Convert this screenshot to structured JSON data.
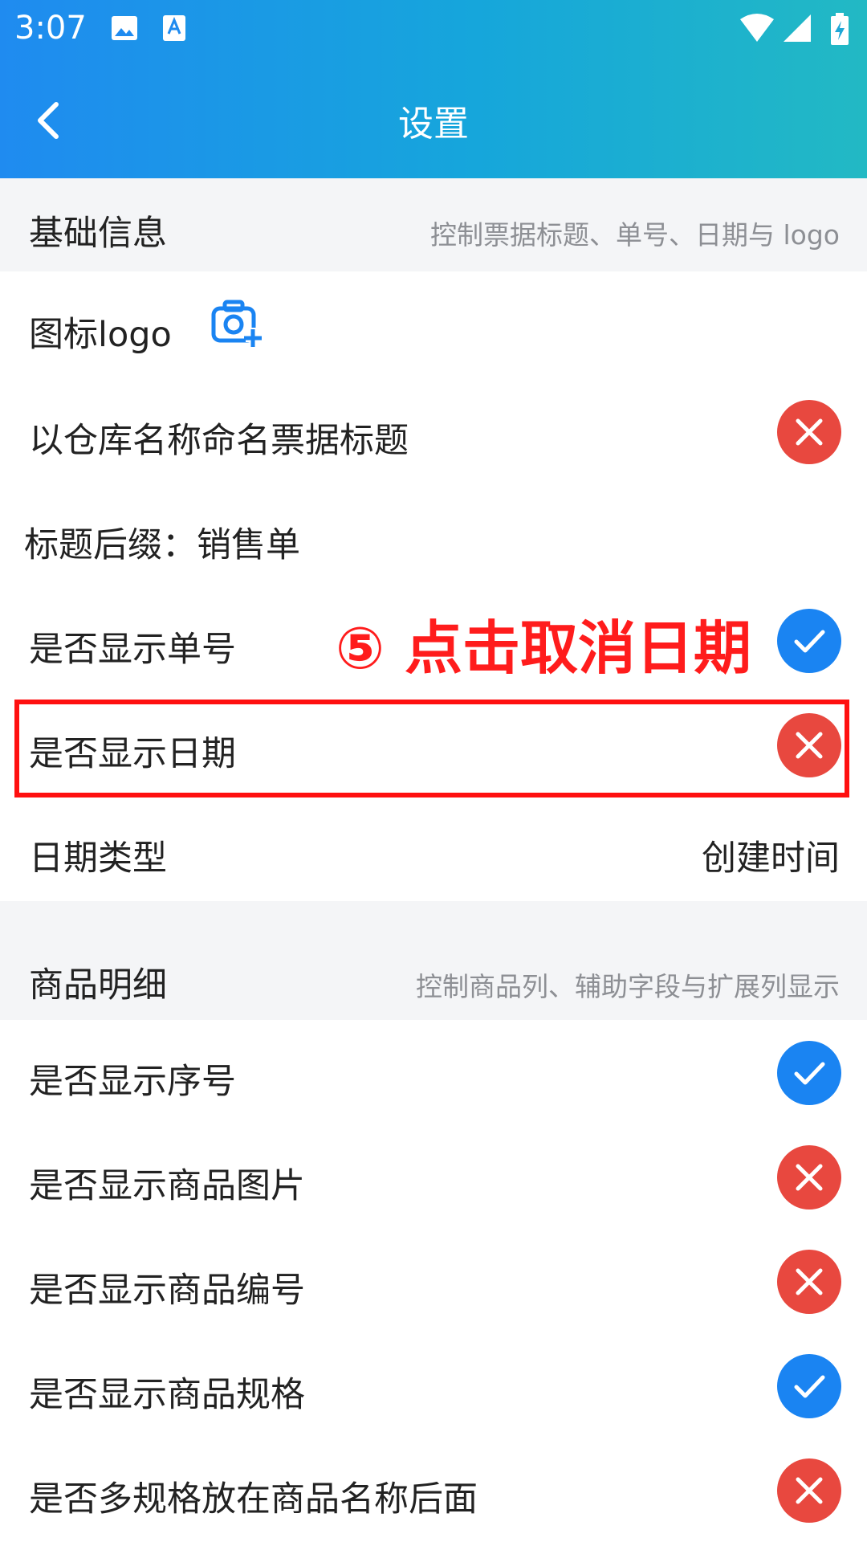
{
  "status_bar": {
    "time": "3:07"
  },
  "nav": {
    "title": "设置"
  },
  "sections": {
    "basic": {
      "title": "基础信息",
      "desc": "控制票据标题、单号、日期与 logo"
    },
    "goods": {
      "title": "商品明细",
      "desc": "控制商品列、辅助字段与扩展列显示"
    }
  },
  "rows": {
    "logo": {
      "label": "图标logo"
    },
    "use_warehouse_title": {
      "label": "以仓库名称命名票据标题",
      "state": "off"
    },
    "title_suffix": {
      "label": "标题后缀：销售单"
    },
    "show_order_no": {
      "label": "是否显示单号",
      "state": "on"
    },
    "show_date": {
      "label": "是否显示日期",
      "state": "off"
    },
    "date_type": {
      "label": "日期类型",
      "value": "创建时间"
    },
    "show_seq": {
      "label": "是否显示序号",
      "state": "on"
    },
    "show_goods_image": {
      "label": "是否显示商品图片",
      "state": "off"
    },
    "show_goods_code": {
      "label": "是否显示商品编号",
      "state": "off"
    },
    "show_goods_spec": {
      "label": "是否显示商品规格",
      "state": "on"
    },
    "multi_spec_after_name": {
      "label": "是否多规格放在商品名称后面",
      "state": "off"
    }
  },
  "annotation": {
    "text": "⑤ 点击取消日期"
  },
  "colors": {
    "accent": "#1a84f2",
    "off": "#e8483f",
    "annotation": "#ff1c1c"
  }
}
